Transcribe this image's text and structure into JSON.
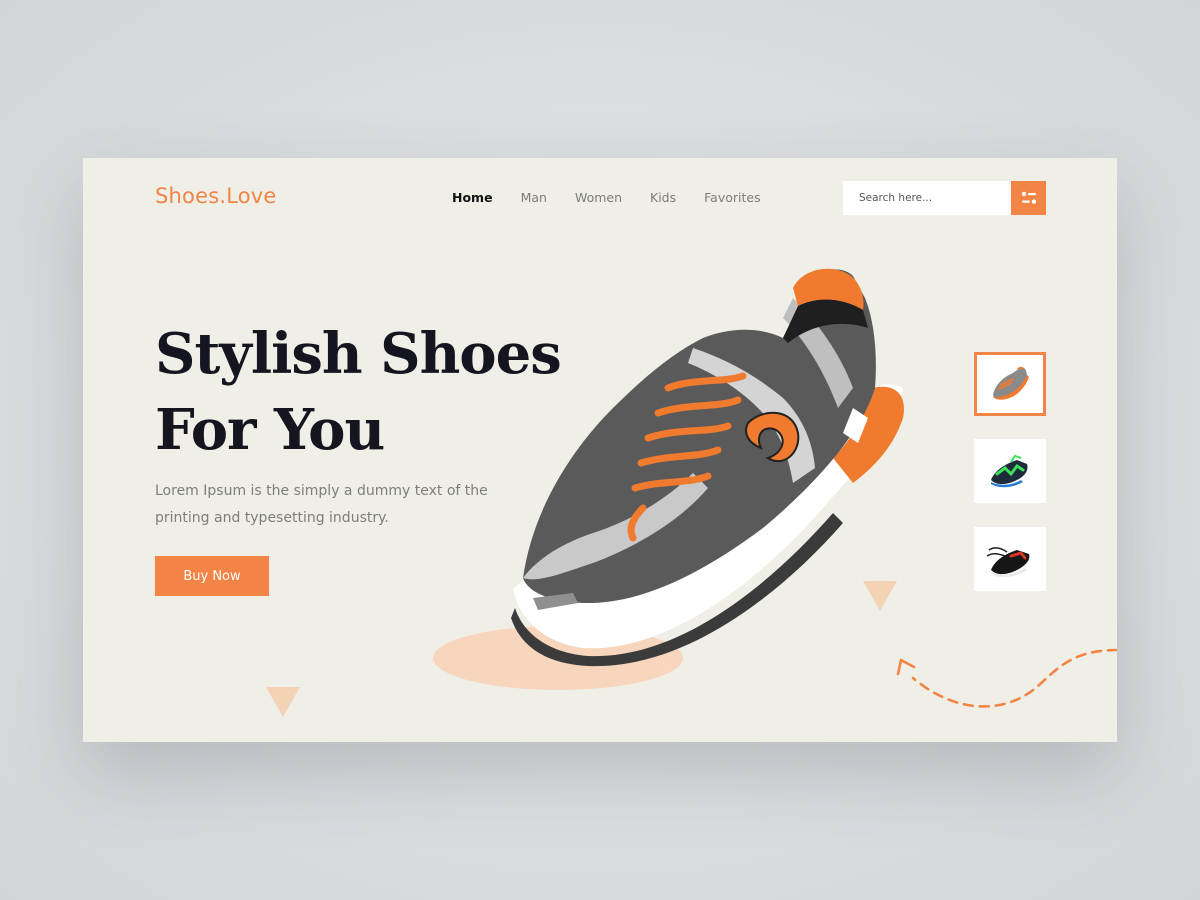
{
  "header": {
    "logo": "Shoes.Love",
    "nav": [
      {
        "label": "Home",
        "active": true
      },
      {
        "label": "Man",
        "active": false
      },
      {
        "label": "Women",
        "active": false
      },
      {
        "label": "Kids",
        "active": false
      },
      {
        "label": "Favorites",
        "active": false
      }
    ],
    "search": {
      "placeholder": "Search here...",
      "button_icon": "filter-icon"
    }
  },
  "hero": {
    "headline_line1": "Stylish Shoes",
    "headline_line2": "For You",
    "description": "Lorem Ipsum is the simply a dummy text of the printing and typesetting industry.",
    "cta_label": "Buy Now"
  },
  "thumbnails": [
    {
      "icon": "orange-sneaker-thumbnail",
      "selected": true
    },
    {
      "icon": "green-sneaker-thumbnail",
      "selected": false
    },
    {
      "icon": "black-sneaker-thumbnail",
      "selected": false
    }
  ],
  "colors": {
    "accent": "#f28445",
    "background": "#f0efe7",
    "headline": "#14151f",
    "muted_text": "#7d7d7d",
    "ellipse": "#f7d6bd"
  }
}
